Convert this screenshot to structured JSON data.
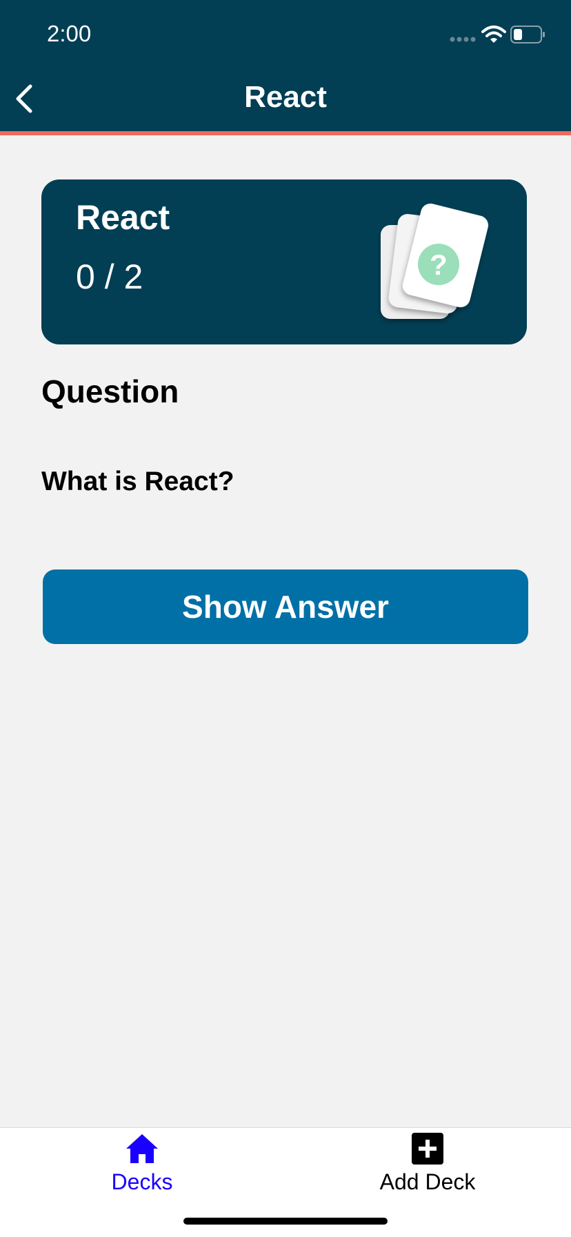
{
  "status_bar": {
    "time": "2:00",
    "icons": [
      "signal-icon",
      "wifi-icon",
      "battery-icon"
    ]
  },
  "nav": {
    "title": "React",
    "back_icon": "chevron-left-icon"
  },
  "deck_card": {
    "title": "React",
    "progress": "0 / 2",
    "icon": "question-cards-icon"
  },
  "question": {
    "heading": "Question",
    "text": "What is React?"
  },
  "actions": {
    "show_answer_label": "Show Answer"
  },
  "tab_bar": {
    "items": [
      {
        "label": "Decks",
        "icon": "home-icon",
        "active": true
      },
      {
        "label": "Add Deck",
        "icon": "plus-square-icon",
        "active": false
      }
    ]
  },
  "colors": {
    "header_bg": "#023f55",
    "header_accent": "#f06a5a",
    "button_bg": "#0070a6",
    "tab_active": "#1a00ff",
    "page_bg": "#f2f2f2",
    "question_mark_green": "#9adfb9"
  }
}
